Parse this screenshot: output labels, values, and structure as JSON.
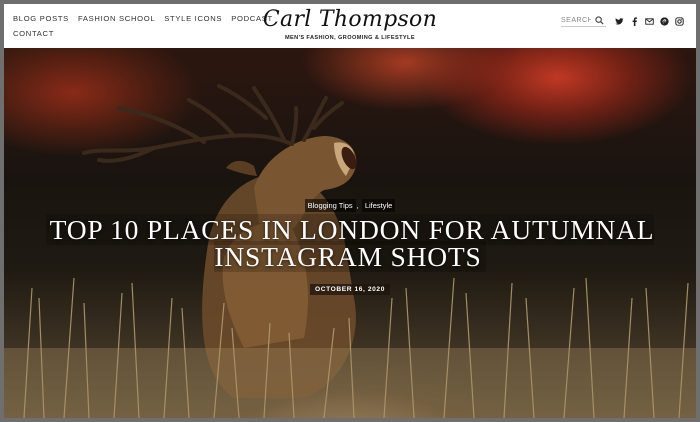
{
  "nav": {
    "items": [
      {
        "label": "BLOG POSTS"
      },
      {
        "label": "FASHION SCHOOL"
      },
      {
        "label": "STYLE ICONS"
      },
      {
        "label": "PODCAST"
      },
      {
        "label": "CONTACT"
      }
    ]
  },
  "brand": {
    "name": "Carl Thompson",
    "tagline": "MEN'S FASHION, GROOMING & LIFESTYLE"
  },
  "search": {
    "placeholder": "SEARCH"
  },
  "social": {
    "icons": [
      "twitter-icon",
      "facebook-icon",
      "email-icon",
      "pinterest-icon",
      "instagram-icon"
    ]
  },
  "hero": {
    "categories": [
      "Blogging Tips",
      "Lifestyle"
    ],
    "category_separator": ",",
    "title": "TOP 10 PLACES IN LONDON FOR AUTUMNAL INSTAGRAM SHOTS",
    "date": "OCTOBER 16, 2020"
  },
  "colors": {
    "frame": "#6f6f6f",
    "header_bg": "#ffffff",
    "text_dark": "#333333",
    "title_text": "#ffffff"
  }
}
